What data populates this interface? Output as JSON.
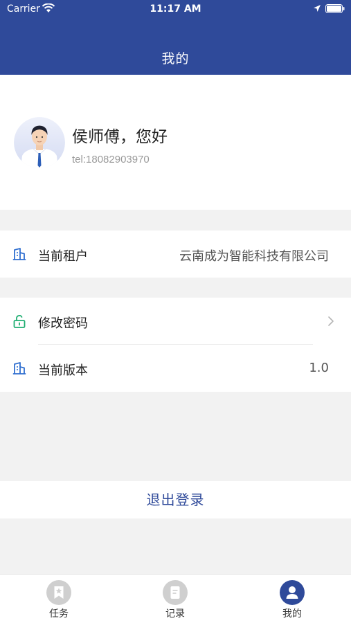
{
  "status_bar": {
    "carrier": "Carrier",
    "time": "11:17 AM",
    "wifi_icon": "wifi-icon",
    "location_icon": "location-arrow-icon",
    "battery_icon": "battery-icon"
  },
  "header": {
    "title": "我的",
    "background_color": "#2f4a9a"
  },
  "profile": {
    "greeting": "侯师傅，您好",
    "phone": "tel:18082903970",
    "avatar_icon": "user-avatar"
  },
  "tenant": {
    "label": "当前租户",
    "value": "云南成为智能科技有限公司",
    "icon": "building-icon"
  },
  "settings": {
    "change_password_label": "修改密码",
    "change_password_icon": "unlock-icon",
    "version_label": "当前版本",
    "version_value": "1.0",
    "version_icon": "building-icon"
  },
  "logout": {
    "label": "退出登录"
  },
  "tabbar": {
    "tabs": [
      {
        "label": "任务",
        "icon": "task-bookmark-icon",
        "active": false
      },
      {
        "label": "记录",
        "icon": "record-document-icon",
        "active": false
      },
      {
        "label": "我的",
        "icon": "person-icon",
        "active": true
      }
    ],
    "active_color": "#2f4a9a",
    "inactive_color": "#cfcfcf"
  }
}
